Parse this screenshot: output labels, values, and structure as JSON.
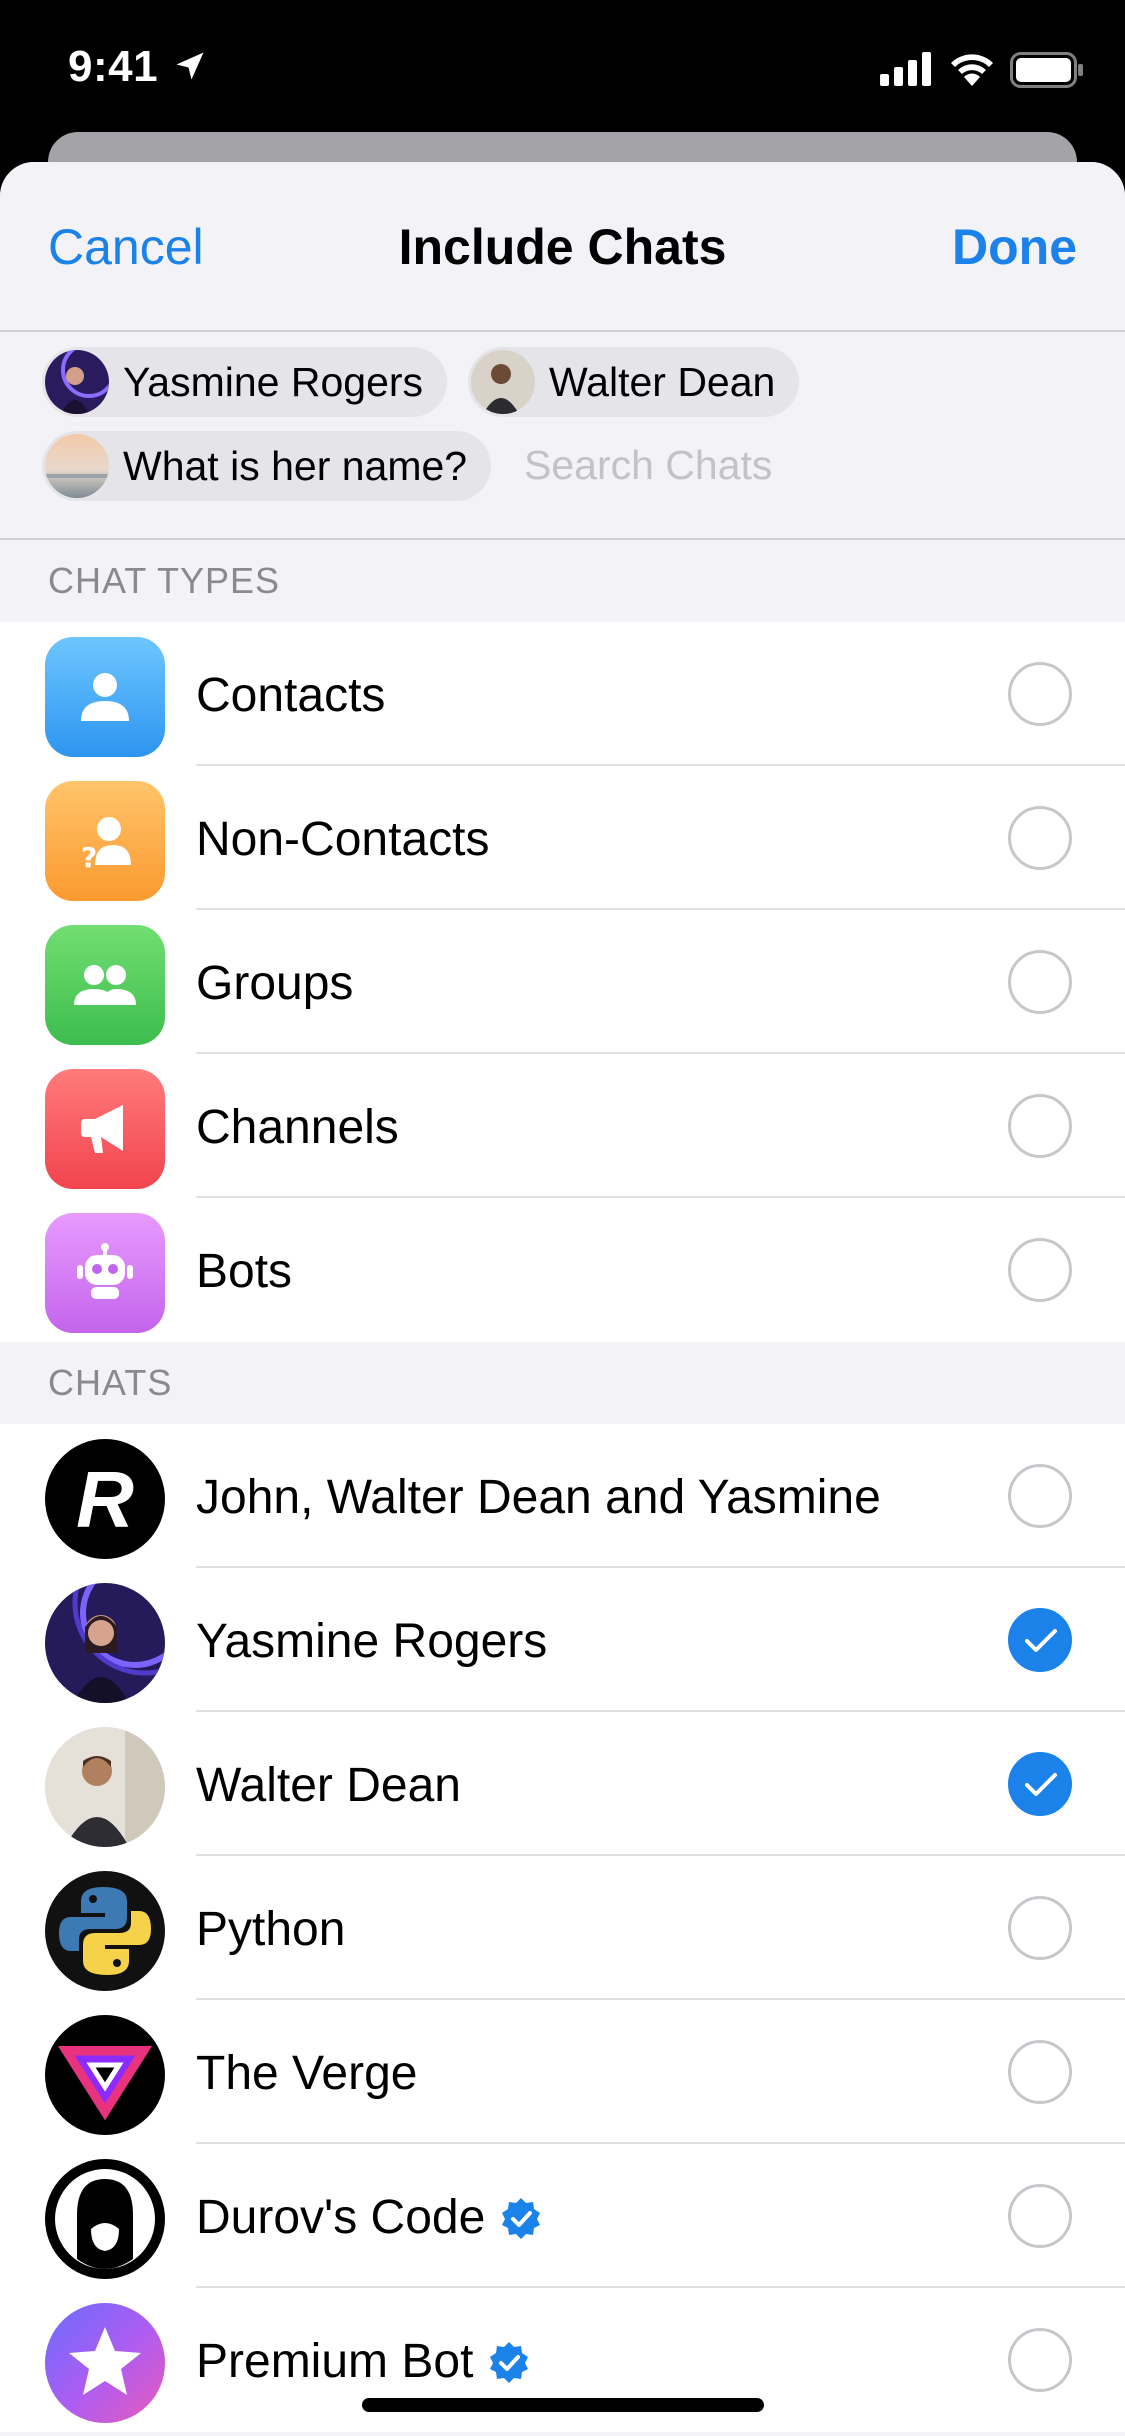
{
  "status": {
    "time": "9:41"
  },
  "nav": {
    "cancel": "Cancel",
    "title": "Include Chats",
    "done": "Done"
  },
  "selected_chips": [
    {
      "label": "Yasmine Rogers"
    },
    {
      "label": "Walter Dean"
    },
    {
      "label": "What is her name?"
    }
  ],
  "search": {
    "placeholder": "Search Chats"
  },
  "chat_types": {
    "header": "CHAT TYPES",
    "items": [
      {
        "label": "Contacts",
        "icon": "person-icon",
        "color": "#48aaf7",
        "checked": false
      },
      {
        "label": "Non-Contacts",
        "icon": "person-question-icon",
        "color": "#fca94a",
        "checked": false
      },
      {
        "label": "Groups",
        "icon": "group-icon",
        "color": "#4fcc5d",
        "checked": false
      },
      {
        "label": "Channels",
        "icon": "megaphone-icon",
        "color": "#f7545b",
        "checked": false
      },
      {
        "label": "Bots",
        "icon": "robot-icon",
        "color": "#d67df0",
        "checked": false
      }
    ]
  },
  "chats": {
    "header": "CHATS",
    "items": [
      {
        "label": "John, Walter Dean and Yasmine",
        "checked": false,
        "verified": false
      },
      {
        "label": "Yasmine Rogers",
        "checked": true,
        "verified": false
      },
      {
        "label": "Walter Dean",
        "checked": true,
        "verified": false
      },
      {
        "label": "Python",
        "checked": false,
        "verified": false
      },
      {
        "label": "The Verge",
        "checked": false,
        "verified": false
      },
      {
        "label": "Durov's Code",
        "checked": false,
        "verified": true
      },
      {
        "label": "Premium Bot",
        "checked": false,
        "verified": true
      }
    ]
  },
  "colors": {
    "accent": "#1a82e8",
    "background": "#f2f2f7"
  }
}
